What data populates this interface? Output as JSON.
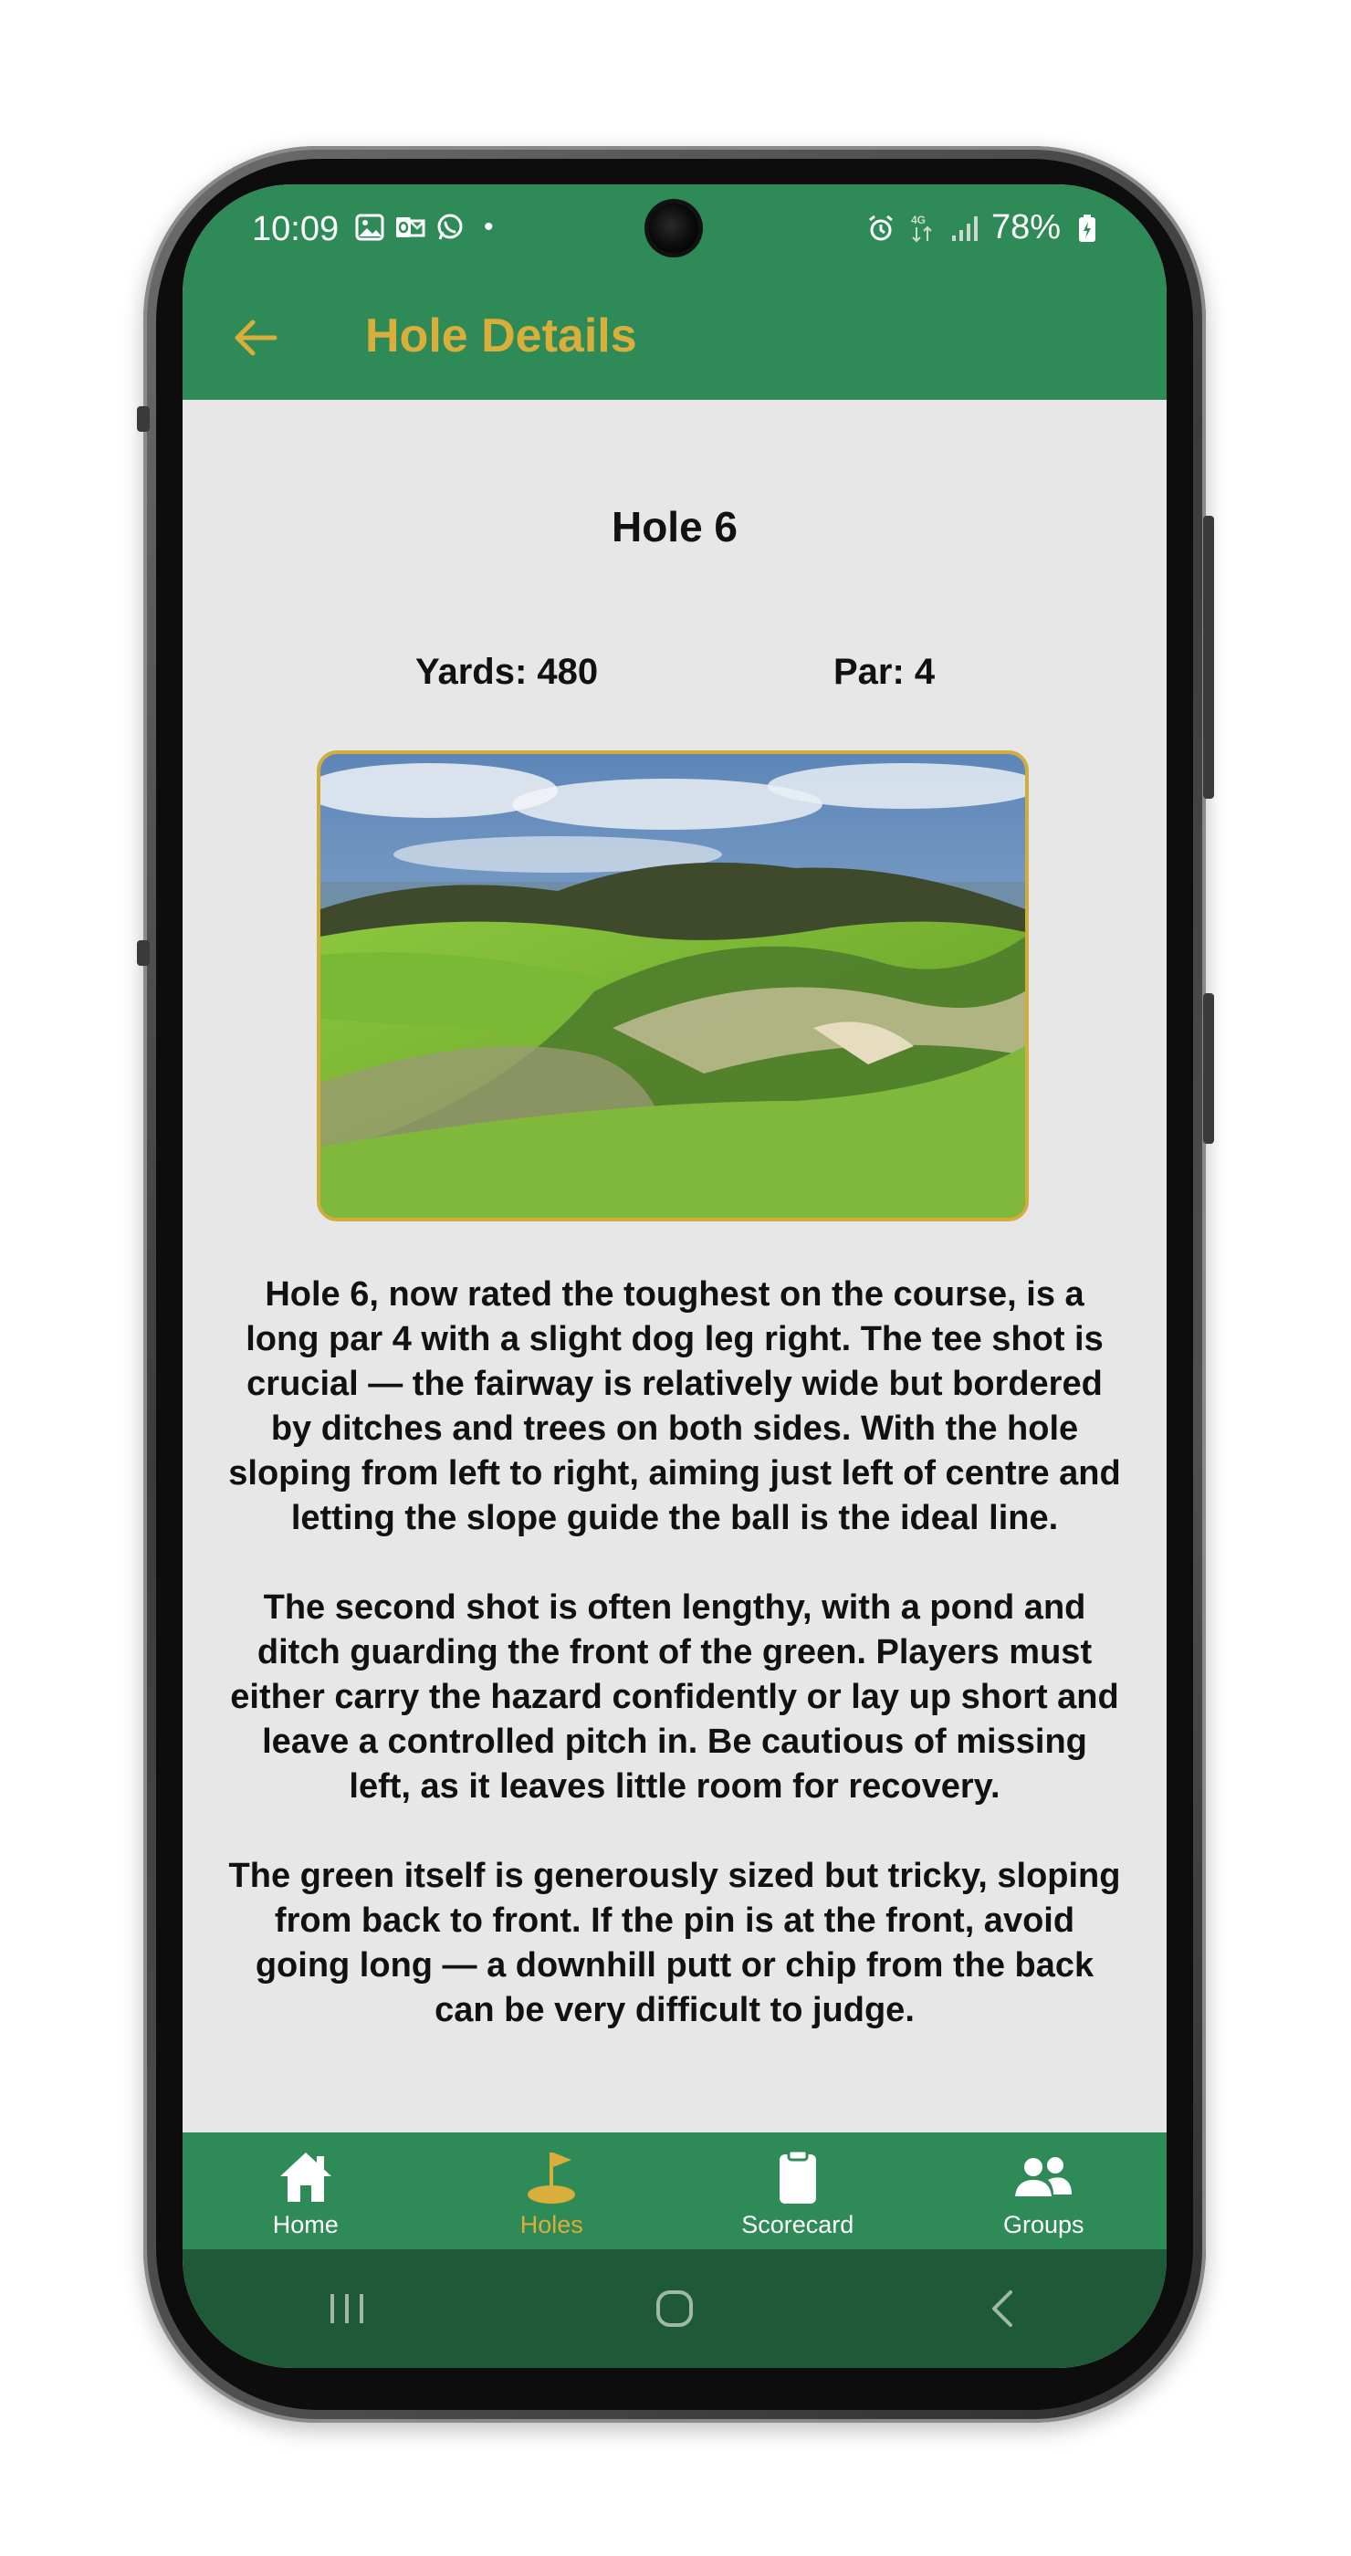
{
  "status_bar": {
    "time": "10:09",
    "battery": "78%",
    "network": "4G"
  },
  "app_bar": {
    "title": "Hole Details"
  },
  "hole": {
    "title": "Hole 6",
    "yards": "Yards: 480",
    "par": "Par: 4",
    "description": [
      "Hole 6, now rated the toughest on the course, is a long par 4 with a slight dog leg right. The tee shot is crucial — the fairway is relatively wide but bordered by ditches and trees on both sides. With the hole sloping from left to right, aiming just left of centre and letting the slope guide the ball is the ideal line.",
      "The second shot is often lengthy, with a pond and ditch guarding the front of the green. Players must either carry the hazard confidently or lay up short and leave a controlled pitch in. Be cautious of missing left, as it leaves little room for recovery.",
      "The green itself is generously sized but tricky, sloping from back to front. If the pin is at the front, avoid going long — a downhill putt or chip from the back can be very difficult to judge."
    ]
  },
  "bottom_nav": {
    "items": [
      {
        "label": "Home",
        "icon": "home-icon"
      },
      {
        "label": "Holes",
        "icon": "golf-flag-icon",
        "active": true
      },
      {
        "label": "Scorecard",
        "icon": "clipboard-icon"
      },
      {
        "label": "Groups",
        "icon": "people-icon"
      }
    ]
  },
  "colors": {
    "primary": "#2e8a57",
    "accent": "#d9ae3a",
    "background": "#e7e7e7",
    "system_nav": "#1e5a37"
  }
}
